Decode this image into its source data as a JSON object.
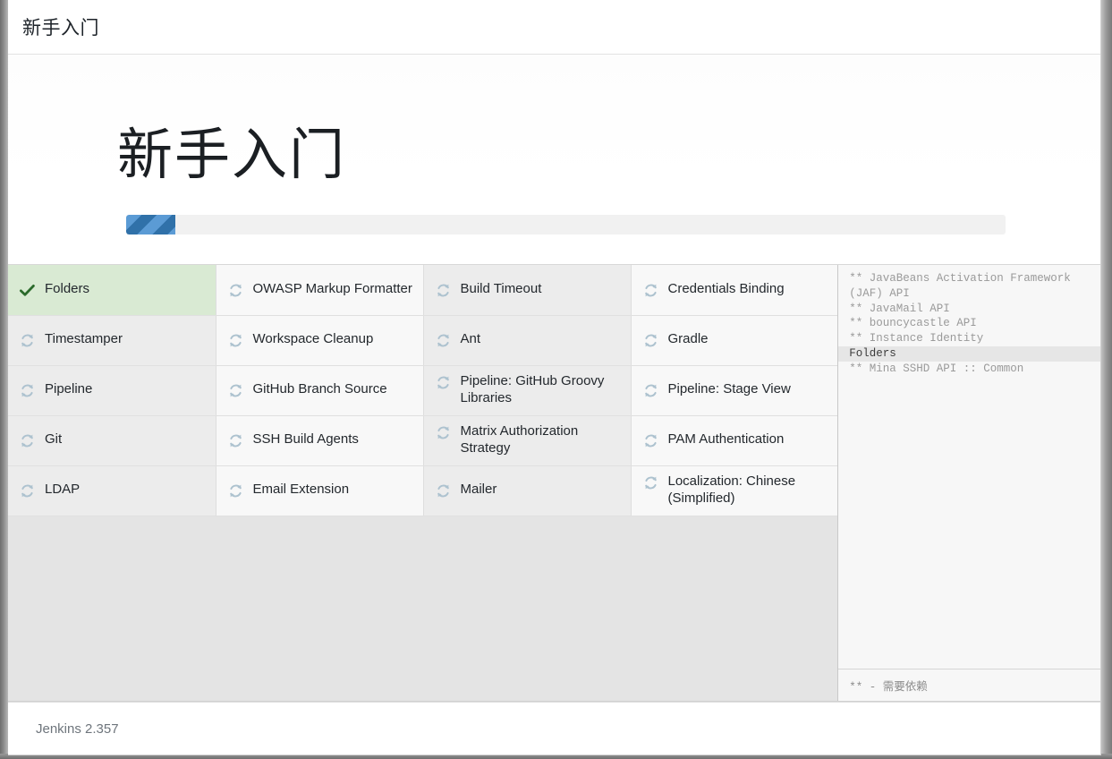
{
  "appbar": {
    "breadcrumb": "新手入门"
  },
  "hero": {
    "title": "新手入门",
    "progress_percent": 5.6,
    "progress_fill_color": "#3071a9",
    "progress_stripe_color": "#5b9bd5",
    "progress_track_color": "#f1f1f1"
  },
  "icons": {
    "success": "check-icon",
    "pending": "sync-arrows-icon"
  },
  "colors": {
    "success_cell_bg": "#d9ead3",
    "success_check": "#2b6a2b",
    "pending_icon": "#adc2cf",
    "log_current_bg": "#e6e6e6"
  },
  "plugin_grid": {
    "rows": [
      [
        {
          "name": "Folders",
          "status": "success"
        },
        {
          "name": "OWASP Markup Formatter",
          "status": "pending"
        },
        {
          "name": "Build Timeout",
          "status": "pending"
        },
        {
          "name": "Credentials Binding",
          "status": "pending"
        }
      ],
      [
        {
          "name": "Timestamper",
          "status": "pending"
        },
        {
          "name": "Workspace Cleanup",
          "status": "pending"
        },
        {
          "name": "Ant",
          "status": "pending"
        },
        {
          "name": "Gradle",
          "status": "pending"
        }
      ],
      [
        {
          "name": "Pipeline",
          "status": "pending"
        },
        {
          "name": "GitHub Branch Source",
          "status": "pending"
        },
        {
          "name": "Pipeline: GitHub Groovy Libraries",
          "status": "pending"
        },
        {
          "name": "Pipeline: Stage View",
          "status": "pending"
        }
      ],
      [
        {
          "name": "Git",
          "status": "pending"
        },
        {
          "name": "SSH Build Agents",
          "status": "pending"
        },
        {
          "name": "Matrix Authorization Strategy",
          "status": "pending"
        },
        {
          "name": "PAM Authentication",
          "status": "pending"
        }
      ],
      [
        {
          "name": "LDAP",
          "status": "pending"
        },
        {
          "name": "Email Extension",
          "status": "pending"
        },
        {
          "name": "Mailer",
          "status": "pending"
        },
        {
          "name": "Localization: Chinese (Simplified)",
          "status": "pending"
        }
      ]
    ]
  },
  "log_panel": {
    "lines": [
      {
        "text": "** JavaBeans Activation Framework (JAF) API",
        "current": false
      },
      {
        "text": "** JavaMail API",
        "current": false
      },
      {
        "text": "** bouncycastle API",
        "current": false
      },
      {
        "text": "** Instance Identity",
        "current": false
      },
      {
        "text": "Folders",
        "current": true
      },
      {
        "text": "** Mina SSHD API :: Common",
        "current": false
      }
    ],
    "legend": "** - 需要依赖"
  },
  "footer": {
    "version": "Jenkins 2.357"
  }
}
